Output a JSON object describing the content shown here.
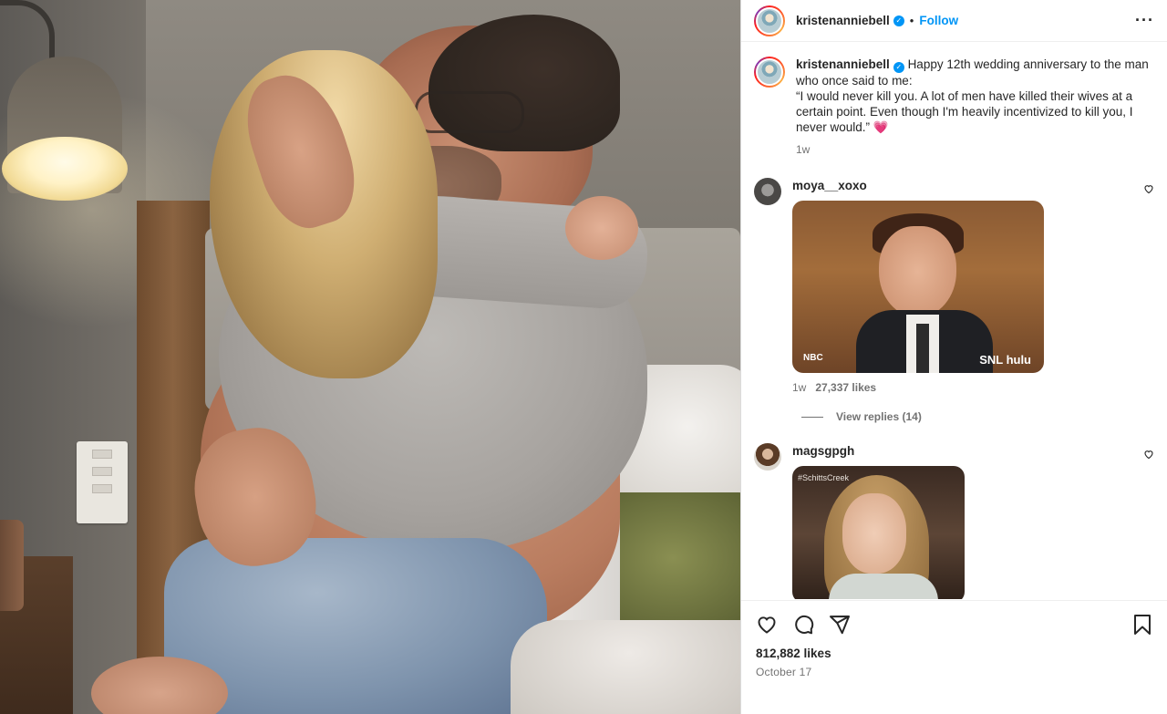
{
  "post": {
    "username": "kristenanniebell",
    "follow_label": "Follow",
    "separator": "•",
    "more_label": "···",
    "caption": "Happy 12th wedding anniversary to the man who once said to me:\n“I would never kill you. A lot of men have killed their wives at a certain point. Even though I'm heavily incentivized to kill you, I never would.” 💗",
    "caption_time": "1w",
    "likes": "812,882 likes",
    "date": "October 17"
  },
  "comments": [
    {
      "username": "moya__xoxo",
      "gif_logo_left": "NBC",
      "gif_logo_right": "SNL hulu",
      "time": "1w",
      "likes": "27,337 likes",
      "view_replies": "View replies (14)"
    },
    {
      "username": "magsgpgh",
      "gif_tag": "#SchittsCreek"
    }
  ],
  "icons": {
    "verified": "verified-badge-icon",
    "heart": "heart-icon",
    "comment": "comment-icon",
    "share": "share-icon",
    "save": "bookmark-icon",
    "more": "more-horizontal-icon"
  },
  "colors": {
    "accent": "#0095f6",
    "text": "#262626",
    "muted": "#737373"
  }
}
